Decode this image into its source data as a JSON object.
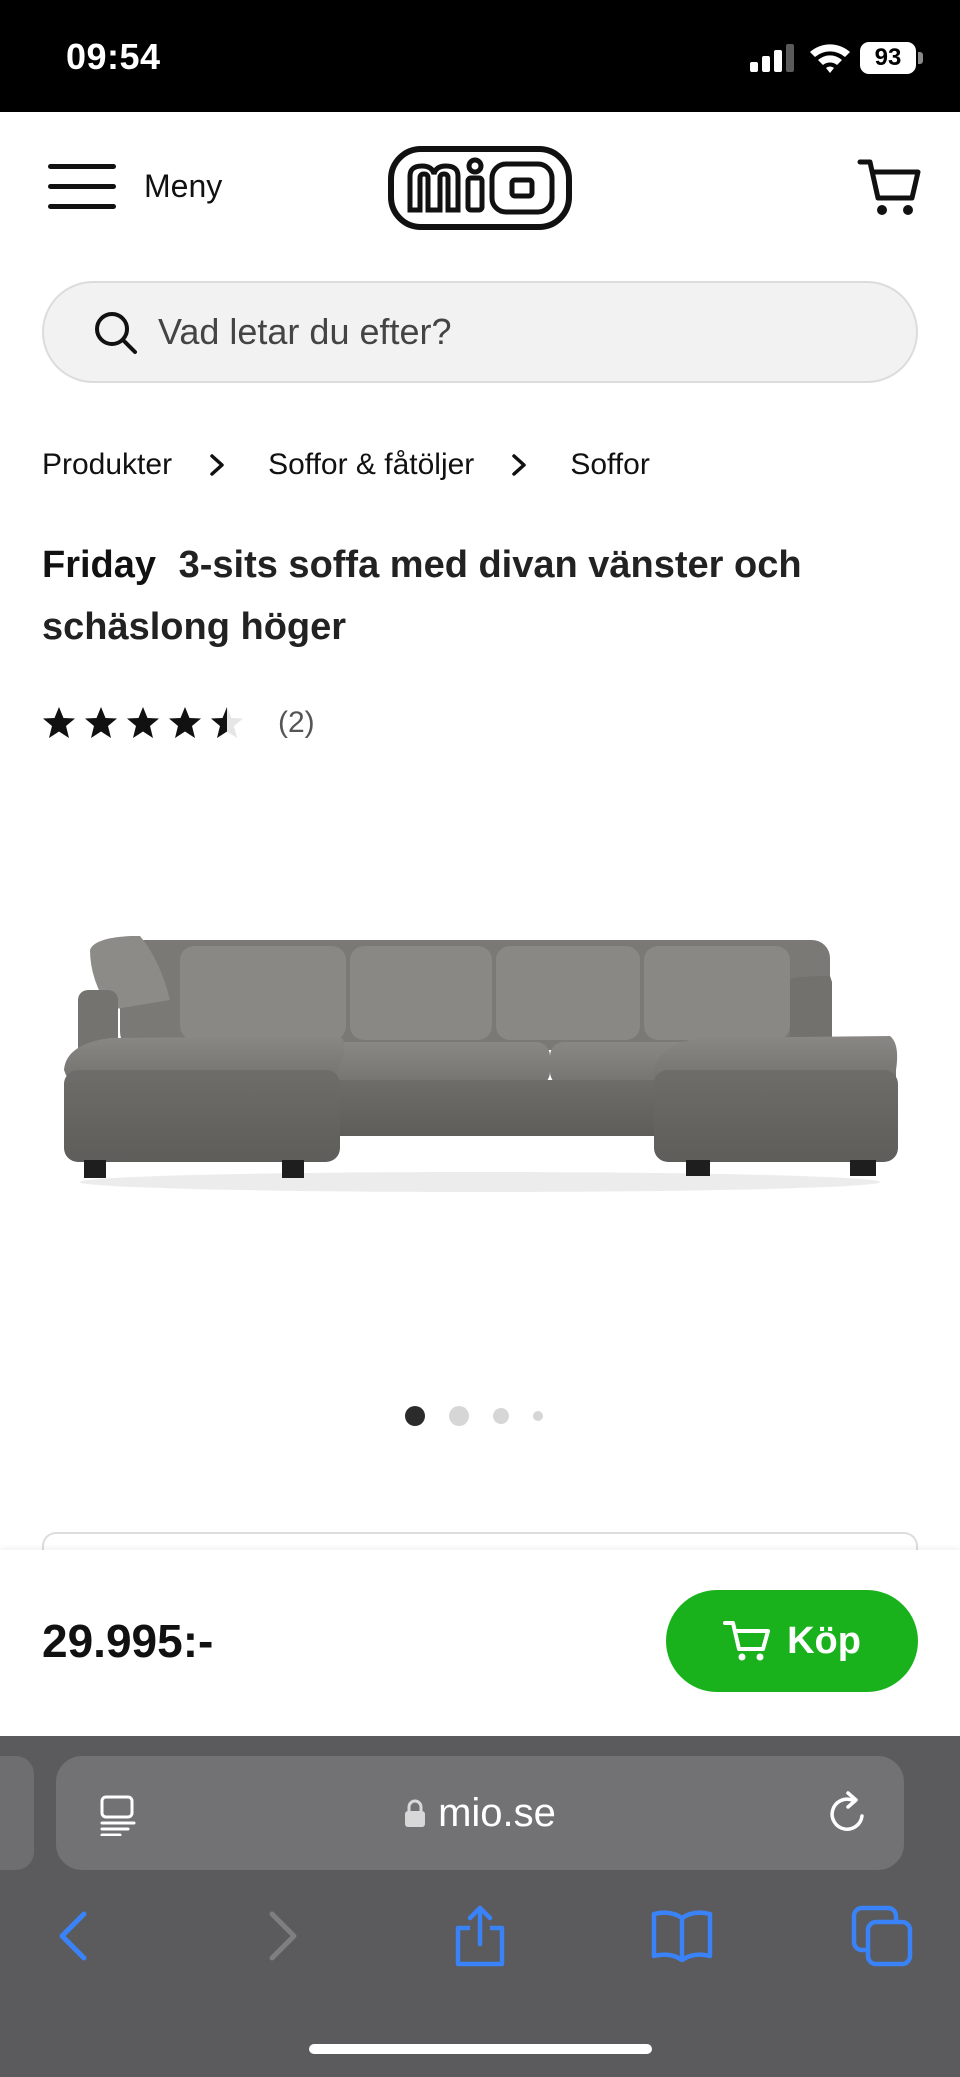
{
  "status_bar": {
    "time": "09:54",
    "battery": "93"
  },
  "header": {
    "menu_label": "Meny",
    "logo_text": "mio"
  },
  "search": {
    "placeholder": "Vad letar du efter?"
  },
  "breadcrumb": [
    "Produkter",
    "Soffor & fåtöljer",
    "Soffor"
  ],
  "product": {
    "brand": "Friday",
    "title": "3-sits soffa med divan vänster och schäslong höger",
    "rating": 4.5,
    "review_count": "(2)",
    "image_count": 4,
    "active_image": 1,
    "price": "29.995:-",
    "buy_label": "Köp"
  },
  "browser": {
    "url": "mio.se"
  },
  "colors": {
    "buy_green": "#19b21c",
    "safari_blue": "#3a82f7",
    "safari_bar": "#5b5b5d"
  }
}
